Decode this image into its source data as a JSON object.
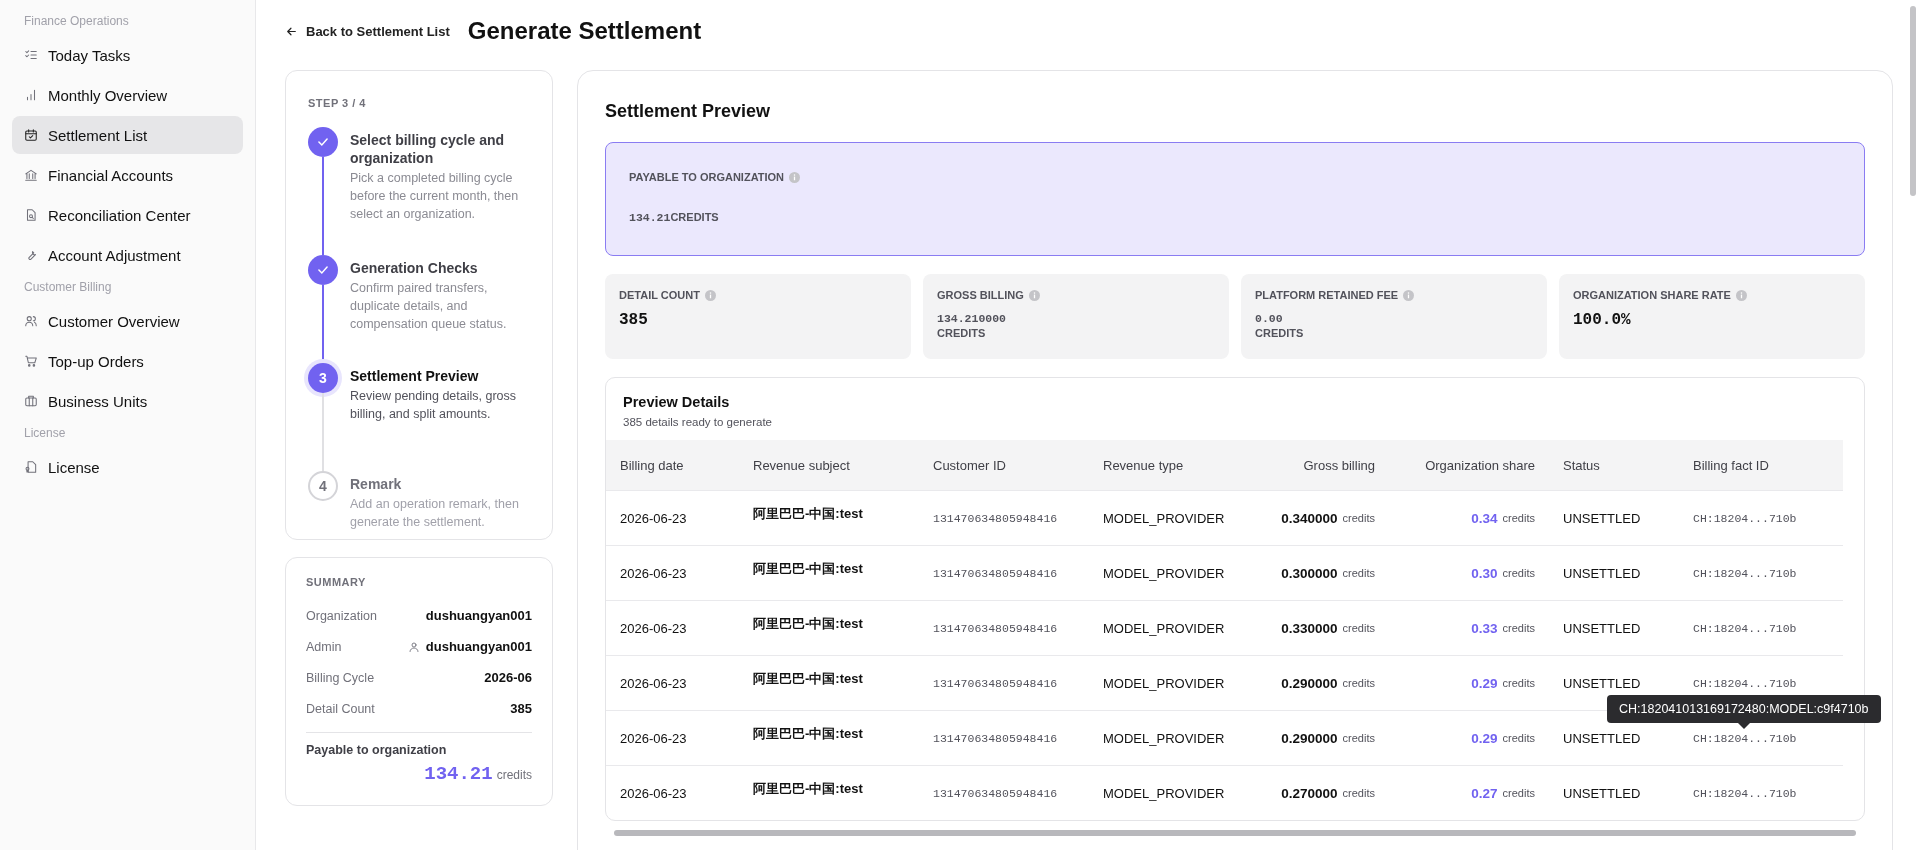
{
  "sidebar": {
    "sections": [
      {
        "title": "Finance Operations",
        "items": [
          {
            "label": "Today Tasks",
            "selected": false
          },
          {
            "label": "Monthly Overview",
            "selected": false
          },
          {
            "label": "Settlement List",
            "selected": true
          },
          {
            "label": "Financial Accounts",
            "selected": false
          },
          {
            "label": "Reconciliation Center",
            "selected": false
          },
          {
            "label": "Account Adjustment",
            "selected": false
          }
        ]
      },
      {
        "title": "Customer Billing",
        "items": [
          {
            "label": "Customer Overview",
            "selected": false
          },
          {
            "label": "Top-up Orders",
            "selected": false
          },
          {
            "label": "Business Units",
            "selected": false
          }
        ]
      },
      {
        "title": "License",
        "items": [
          {
            "label": "License",
            "selected": false
          }
        ]
      }
    ]
  },
  "header": {
    "back_link": "Back to Settlement List",
    "title": "Generate Settlement"
  },
  "stepper": {
    "label": "STEP 3 / 4",
    "steps": [
      {
        "done": true,
        "current": false,
        "title": "Select billing cycle and organization",
        "description": "Pick a completed billing cycle before the current month, then select an organization."
      },
      {
        "done": true,
        "current": false,
        "title": "Generation Checks",
        "description": "Confirm paired transfers, duplicate details, and compensation queue status."
      },
      {
        "done": false,
        "current": true,
        "number": "3",
        "title": "Settlement Preview",
        "description": "Review pending details, gross billing, and split amounts."
      },
      {
        "done": false,
        "current": false,
        "number": "4",
        "title": "Remark",
        "description": "Add an operation remark, then generate the settlement."
      }
    ]
  },
  "summary": {
    "title": "SUMMARY",
    "rows": [
      {
        "kind": "text",
        "label": "Organization",
        "value": "dushuangyan001"
      },
      {
        "kind": "user",
        "label": "Admin",
        "value": "dushuangyan001"
      },
      {
        "kind": "text",
        "label": "Billing Cycle",
        "value": "2026-06"
      },
      {
        "kind": "text",
        "label": "Detail Count",
        "value": "385"
      }
    ],
    "payable_label": "Payable to organization",
    "payable_amount": "134.21",
    "payable_unit": "credits"
  },
  "preview": {
    "title": "Settlement Preview",
    "payable": {
      "label": "PAYABLE TO ORGANIZATION",
      "value": "134.21",
      "unit": "CREDITS"
    },
    "stats": [
      {
        "label": "DETAIL COUNT",
        "value": "385"
      },
      {
        "label": "GROSS BILLING",
        "value": "134.210000",
        "unit": "CREDITS"
      },
      {
        "label": "PLATFORM RETAINED FEE",
        "value": "0.00",
        "unit": "CREDITS"
      },
      {
        "label": "ORGANIZATION SHARE RATE",
        "value": "100.0%"
      }
    ],
    "details": {
      "title": "Preview Details",
      "subtitle": "385 details ready to generate",
      "columns": [
        "Billing date",
        "Revenue subject",
        "Customer ID",
        "Revenue type",
        "Gross billing",
        "Organization share",
        "Status",
        "Billing fact ID"
      ],
      "rows": [
        {
          "date": "2026-06-23",
          "subject": "阿里巴巴-中国:test",
          "customer_id": "131470634805948416",
          "type": "MODEL_PROVIDER",
          "gross": "0.340000",
          "gross_unit": "credits",
          "share": "0.34",
          "share_unit": "credits",
          "status": "UNSETTLED",
          "fact_id": "CH:18204...710b"
        },
        {
          "date": "2026-06-23",
          "subject": "阿里巴巴-中国:test",
          "customer_id": "131470634805948416",
          "type": "MODEL_PROVIDER",
          "gross": "0.300000",
          "gross_unit": "credits",
          "share": "0.30",
          "share_unit": "credits",
          "status": "UNSETTLED",
          "fact_id": "CH:18204...710b"
        },
        {
          "date": "2026-06-23",
          "subject": "阿里巴巴-中国:test",
          "customer_id": "131470634805948416",
          "type": "MODEL_PROVIDER",
          "gross": "0.330000",
          "gross_unit": "credits",
          "share": "0.33",
          "share_unit": "credits",
          "status": "UNSETTLED",
          "fact_id": "CH:18204...710b"
        },
        {
          "date": "2026-06-23",
          "subject": "阿里巴巴-中国:test",
          "customer_id": "131470634805948416",
          "type": "MODEL_PROVIDER",
          "gross": "0.290000",
          "gross_unit": "credits",
          "share": "0.29",
          "share_unit": "credits",
          "status": "UNSETTLED",
          "fact_id": "CH:18204...710b"
        },
        {
          "date": "2026-06-23",
          "subject": "阿里巴巴-中国:test",
          "customer_id": "131470634805948416",
          "type": "MODEL_PROVIDER",
          "gross": "0.290000",
          "gross_unit": "credits",
          "share": "0.29",
          "share_unit": "credits",
          "status": "UNSETTLED",
          "fact_id": "CH:18204...710b",
          "tooltip": "CH:182041013169172480:MODEL:c9f4710b"
        },
        {
          "date": "2026-06-23",
          "subject": "阿里巴巴-中国:test",
          "customer_id": "131470634805948416",
          "type": "MODEL_PROVIDER",
          "gross": "0.270000",
          "gross_unit": "credits",
          "share": "0.27",
          "share_unit": "credits",
          "status": "UNSETTLED",
          "fact_id": "CH:18204...710b"
        }
      ]
    }
  }
}
